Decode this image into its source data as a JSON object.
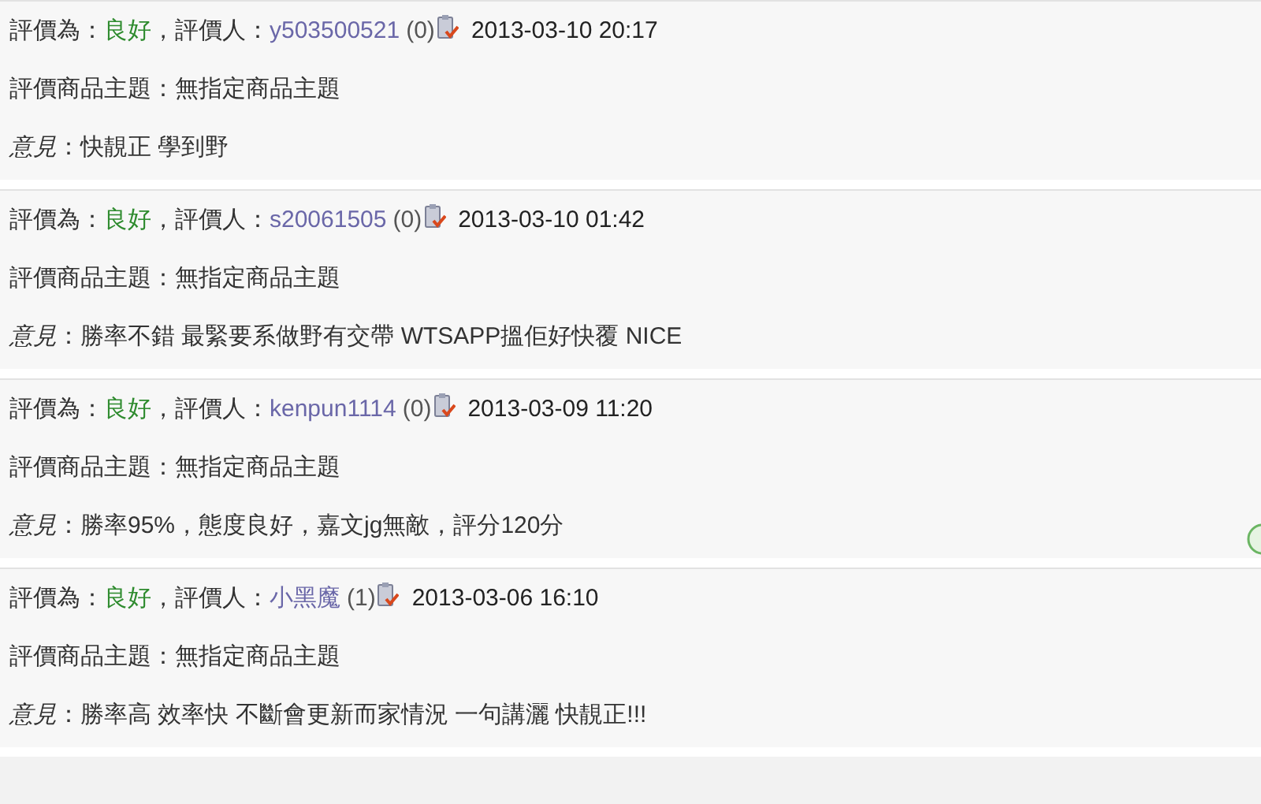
{
  "reviews": [
    {
      "rating_label": "評價為：",
      "rating": "良好",
      "reviewer_label": "，評價人：",
      "reviewer": "y503500521",
      "count": "(0)",
      "date": "2013-03-10 20:17",
      "subject": "評價商品主題：無指定商品主題",
      "comment": "*意見*：快靚正 學到野"
    },
    {
      "rating_label": "評價為：",
      "rating": "良好",
      "reviewer_label": "，評價人：",
      "reviewer": "s20061505",
      "count": "(0)",
      "date": "2013-03-10 01:42",
      "subject": "評價商品主題：無指定商品主題",
      "comment": "*意見*：勝率不錯 最緊要系做野有交帶 WTSAPP搵佢好快覆 NICE"
    },
    {
      "rating_label": "評價為：",
      "rating": "良好",
      "reviewer_label": "，評價人：",
      "reviewer": "kenpun1114",
      "count": "(0)",
      "date": "2013-03-09 11:20",
      "subject": "評價商品主題：無指定商品主題",
      "comment": "*意見*：勝率95%，態度良好，嘉文jg無敵，評分120分"
    },
    {
      "rating_label": "評價為：",
      "rating": "良好",
      "reviewer_label": "，評價人：",
      "reviewer": "小黑魔",
      "count": "(1)",
      "date": "2013-03-06 16:10",
      "subject": "評價商品主題：無指定商品主題",
      "comment": "*意見*：勝率高 效率快 不斷會更新而家情況 一句講灑 快靚正!!!"
    }
  ]
}
